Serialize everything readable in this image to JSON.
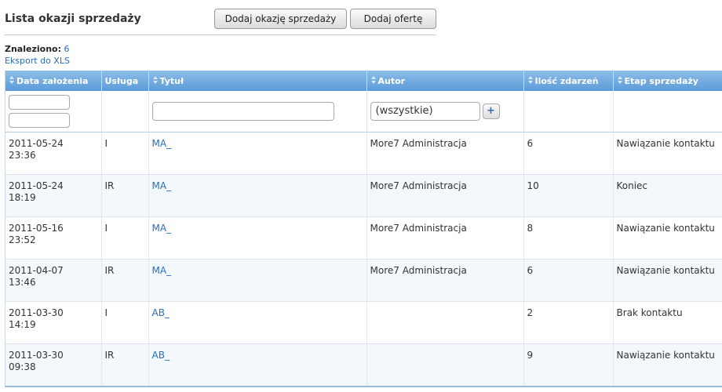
{
  "header": {
    "title": "Lista okazji sprzedaży",
    "add_opportunity_label": "Dodaj okazję sprzedaży",
    "add_offer_label": "Dodaj ofertę"
  },
  "summary": {
    "found_label": "Znaleziono:",
    "found_count": "6",
    "export_label": "Eksport do XLS"
  },
  "grid": {
    "columns": {
      "date": "Data założenia",
      "service": "Usługa",
      "title": "Tytuł",
      "author": "Autor",
      "events": "Ilość zdarzeń",
      "stage": "Etap sprzedaży"
    },
    "filters": {
      "date_from": "",
      "date_to": "",
      "title": "",
      "author_selected": "(wszystkie)",
      "add_symbol": "+"
    },
    "rows": [
      {
        "date": "2011-05-24",
        "time": "23:36",
        "service": "I",
        "title": "MA_",
        "author": "More7 Administracja",
        "events": "6",
        "stage": "Nawiązanie kontaktu"
      },
      {
        "date": "2011-05-24",
        "time": "18:19",
        "service": "IR",
        "title": "MA_",
        "author": "More7 Administracja",
        "events": "10",
        "stage": "Koniec"
      },
      {
        "date": "2011-05-16",
        "time": "23:52",
        "service": "I",
        "title": "MA_",
        "author": "More7 Administracja",
        "events": "8",
        "stage": "Nawiązanie kontaktu"
      },
      {
        "date": "2011-04-07",
        "time": "13:46",
        "service": "IR",
        "title": "MA_",
        "author": "More7 Administracja",
        "events": "6",
        "stage": "Nawiązanie kontaktu"
      },
      {
        "date": "2011-03-30",
        "time": "14:19",
        "service": "I",
        "title": "AB_",
        "author": "",
        "events": "2",
        "stage": "Brak kontaktu"
      },
      {
        "date": "2011-03-30",
        "time": "09:38",
        "service": "IR",
        "title": "AB_",
        "author": "",
        "events": "9",
        "stage": "Nawiązanie kontaktu"
      }
    ]
  },
  "icons": {
    "sort": "sort-arrows-icon",
    "add": "plus-icon"
  },
  "colors": {
    "header_bg": "#6ea8df",
    "link": "#2a6ebb",
    "row_alt": "#f3f8fd"
  }
}
